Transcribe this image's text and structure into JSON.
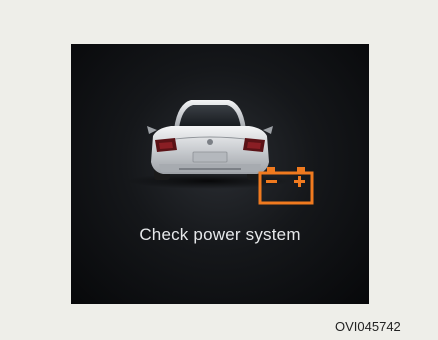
{
  "display": {
    "message": "Check power system",
    "icons": [
      "car-rear-icon",
      "battery-icon"
    ],
    "battery_color": "#f07a1f"
  },
  "figure_code": "OVI045742"
}
